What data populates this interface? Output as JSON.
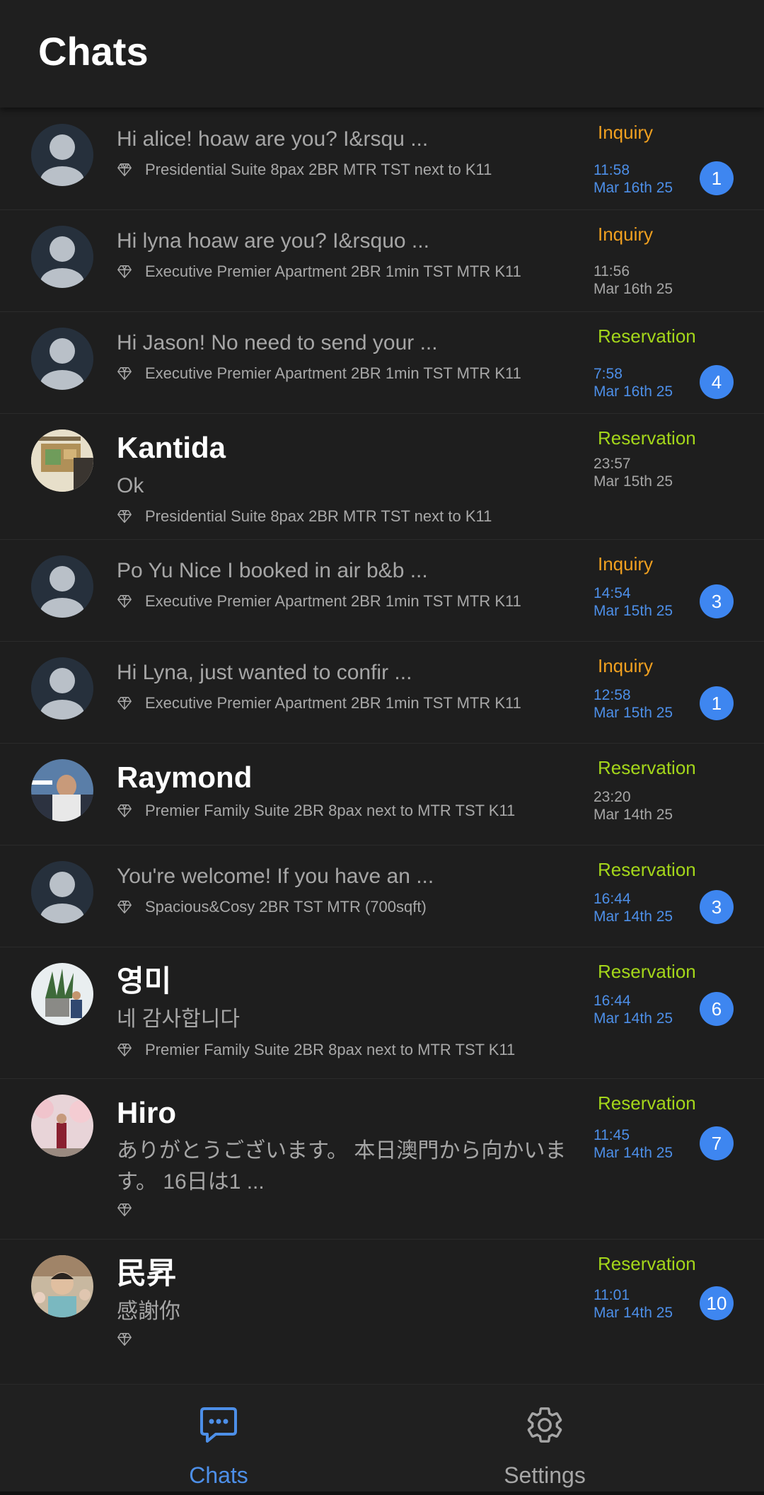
{
  "header": {
    "title": "Chats"
  },
  "colors": {
    "inquiry": "#f0a020",
    "reservation": "#a4d61a",
    "unread_time": "#4d8fe8",
    "badge": "#3e86f0",
    "read_time": "#a6a6a6"
  },
  "chats": [
    {
      "name": "",
      "message": "Hi alice! hoaw are you? I&rsqu ...",
      "listing": "Presidential Suite 8pax 2BR MTR TST next to K11",
      "status": "Inquiry",
      "time": "11:58",
      "date": "Mar 16th 25",
      "badge": "1",
      "avatar": "default-avatar-icon"
    },
    {
      "name": "",
      "message": "Hi lyna hoaw are you? I&rsquo ...",
      "listing": "Executive Premier Apartment 2BR 1min TST MTR K11",
      "status": "Inquiry",
      "time": "11:56",
      "date": "Mar 16th 25",
      "badge": "",
      "avatar": "default-avatar-icon"
    },
    {
      "name": "",
      "message": "Hi Jason! No need to send your ...",
      "listing": "Executive Premier Apartment 2BR 1min TST MTR K11",
      "status": "Reservation",
      "time": "7:58",
      "date": "Mar 16th 25",
      "badge": "4",
      "avatar": "default-avatar-icon"
    },
    {
      "name": "Kantida",
      "message": "Ok",
      "listing": "Presidential Suite 8pax 2BR MTR TST next to K11",
      "status": "Reservation",
      "time": "23:57",
      "date": "Mar 15th 25",
      "badge": "",
      "avatar": "photo-avatar"
    },
    {
      "name": "",
      "message": "Po Yu Nice I booked in air b&b ...",
      "listing": "Executive Premier Apartment 2BR 1min TST MTR K11",
      "status": "Inquiry",
      "time": "14:54",
      "date": "Mar 15th 25",
      "badge": "3",
      "avatar": "default-avatar-icon"
    },
    {
      "name": "",
      "message": "Hi Lyna, just wanted to confir ...",
      "listing": "Executive Premier Apartment 2BR 1min TST MTR K11",
      "status": "Inquiry",
      "time": "12:58",
      "date": "Mar 15th 25",
      "badge": "1",
      "avatar": "default-avatar-icon"
    },
    {
      "name": "Raymond",
      "message": "",
      "listing": "Premier Family Suite 2BR 8pax next to MTR TST K11",
      "status": "Reservation",
      "time": "23:20",
      "date": "Mar 14th 25",
      "badge": "",
      "avatar": "photo-avatar"
    },
    {
      "name": "",
      "message": "You're welcome! If you have an ...",
      "listing": "Spacious&Cosy 2BR TST MTR (700sqft)",
      "status": "Reservation",
      "time": "16:44",
      "date": "Mar 14th 25",
      "badge": "3",
      "avatar": "default-avatar-icon"
    },
    {
      "name": "영미",
      "message": "네 감사합니다",
      "listing": "Premier Family Suite 2BR 8pax next to MTR TST K11",
      "status": "Reservation",
      "time": "16:44",
      "date": "Mar 14th 25",
      "badge": "6",
      "avatar": "photo-avatar"
    },
    {
      "name": "Hiro",
      "message": "ありがとうございます。 本日澳門から向かいます。 16日は1 ...",
      "listing": "",
      "status": "Reservation",
      "time": "11:45",
      "date": "Mar 14th 25",
      "badge": "7",
      "avatar": "photo-avatar"
    },
    {
      "name": "民昇",
      "message": "感謝你",
      "listing": "",
      "status": "Reservation",
      "time": "11:01",
      "date": "Mar 14th 25",
      "badge": "10",
      "avatar": "photo-avatar"
    }
  ],
  "bottom_nav": {
    "chats": {
      "label": "Chats",
      "icon": "chat-bubble-icon",
      "active": true
    },
    "settings": {
      "label": "Settings",
      "icon": "gear-icon",
      "active": false
    }
  }
}
